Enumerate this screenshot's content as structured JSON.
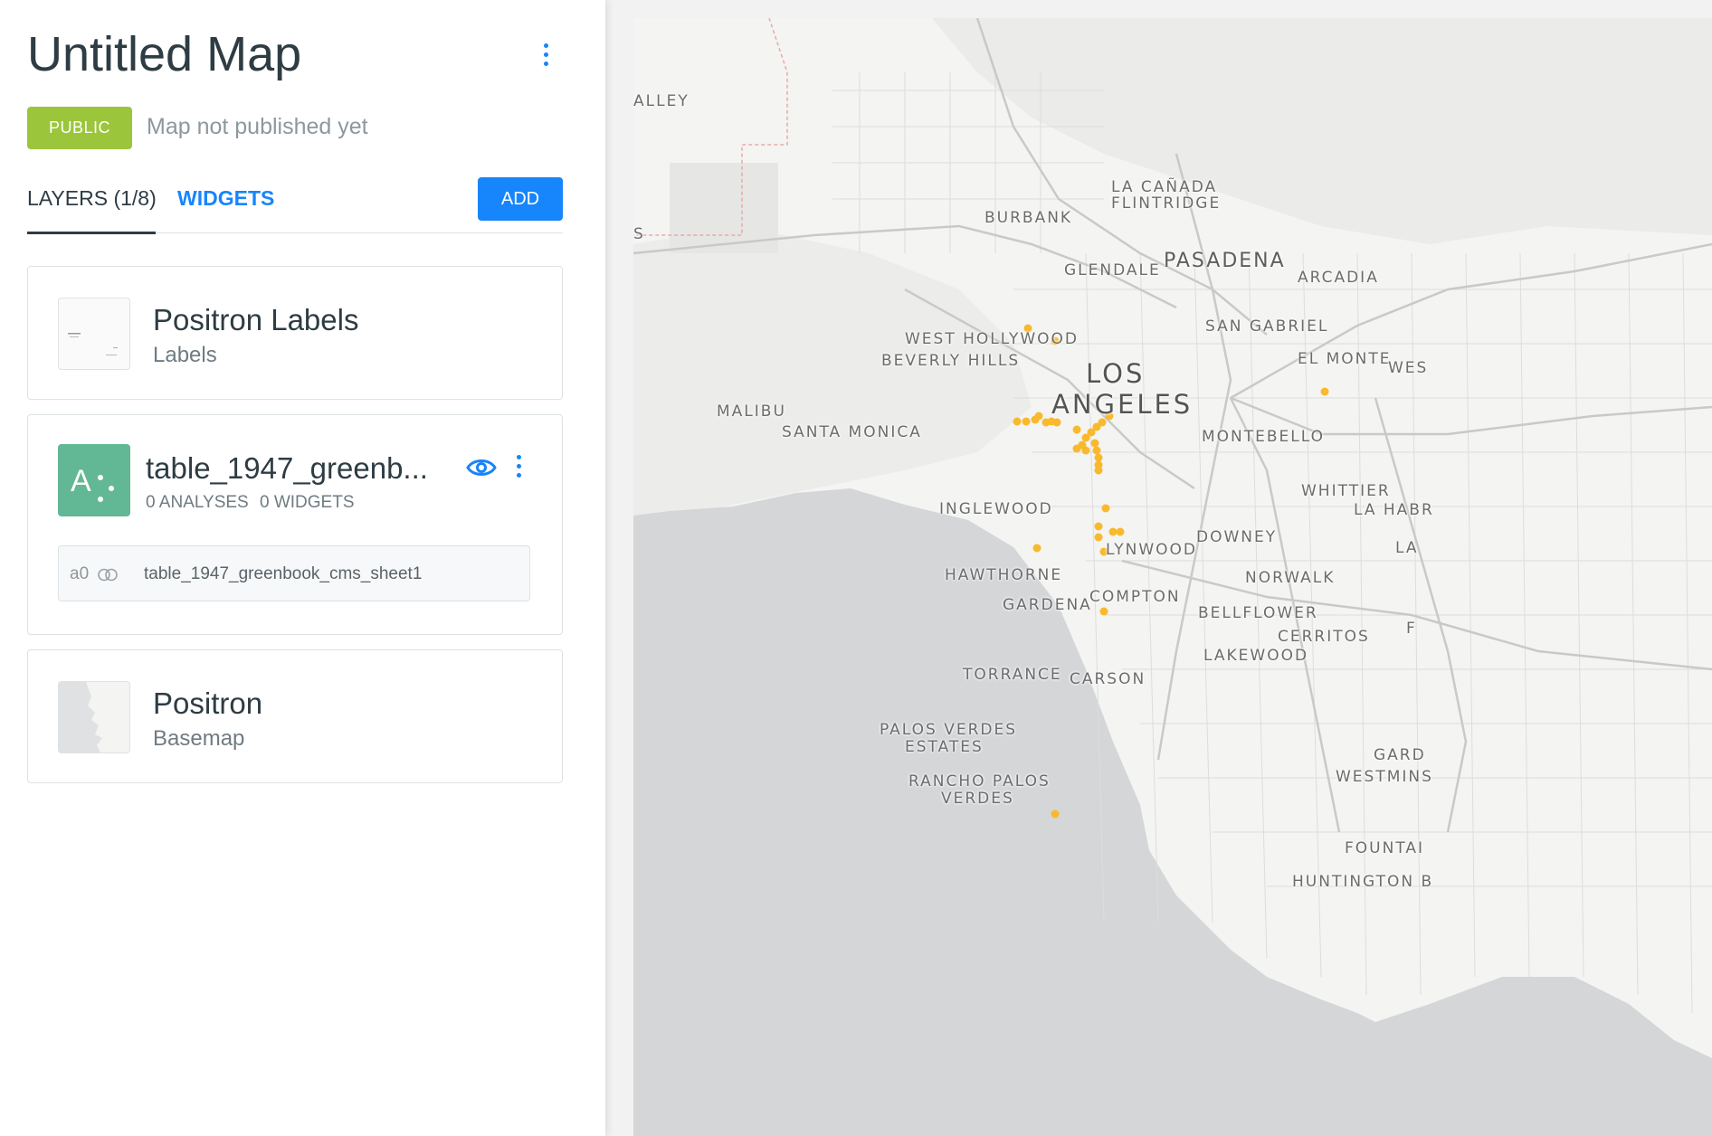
{
  "panel": {
    "title": "Untitled Map",
    "privacy": "PUBLIC",
    "publish_status": "Map not published yet",
    "tabs": [
      {
        "label": "LAYERS (1/8)",
        "active": true
      },
      {
        "label": "WIDGETS",
        "active": false
      }
    ],
    "add_label": "ADD"
  },
  "layers": [
    {
      "title": "Positron Labels",
      "subtitle": "Labels",
      "type": "labels"
    },
    {
      "title": "table_1947_greenb...",
      "source_letter": "A",
      "analyses": "0 ANALYSES",
      "widgets": "0 WIDGETS",
      "analysis_node": {
        "id": "a0",
        "name": "table_1947_greenbook_cms_sheet1"
      },
      "color": "#62b894"
    },
    {
      "title": "Positron",
      "subtitle": "Basemap",
      "type": "basemap"
    }
  ],
  "map": {
    "point_color": "#f9b92c",
    "places": [
      {
        "id": "alley",
        "label": "ALLEY"
      },
      {
        "id": "la-canada",
        "label": "LA CAÑADA"
      },
      {
        "id": "flintridge",
        "label": "FLINTRIDGE"
      },
      {
        "id": "burbank",
        "label": "BURBANK"
      },
      {
        "id": "glendale",
        "label": "GLENDALE"
      },
      {
        "id": "pasadena",
        "label": "PASADENA"
      },
      {
        "id": "arcadia",
        "label": "ARCADIA"
      },
      {
        "id": "san-gabriel",
        "label": "SAN GABRIEL"
      },
      {
        "id": "west-hollywood",
        "label": "WEST HOLLYWOOD"
      },
      {
        "id": "beverly-hills",
        "label": "BEVERLY HILLS"
      },
      {
        "id": "los",
        "label": "LOS"
      },
      {
        "id": "angeles",
        "label": "ANGELES"
      },
      {
        "id": "el-monte",
        "label": "EL MONTE"
      },
      {
        "id": "wes",
        "label": "WES"
      },
      {
        "id": "malibu",
        "label": "MALIBU"
      },
      {
        "id": "santa-monica",
        "label": "SANTA MONICA"
      },
      {
        "id": "montebello",
        "label": "MONTEBELLO"
      },
      {
        "id": "whittier",
        "label": "WHITTIER"
      },
      {
        "id": "la-habr",
        "label": "LA HABR"
      },
      {
        "id": "inglewood",
        "label": "INGLEWOOD"
      },
      {
        "id": "downey",
        "label": "DOWNEY"
      },
      {
        "id": "la",
        "label": "LA"
      },
      {
        "id": "lynwood",
        "label": "LYNWOOD"
      },
      {
        "id": "hawthorne",
        "label": "HAWTHORNE"
      },
      {
        "id": "norwalk",
        "label": "NORWALK"
      },
      {
        "id": "gardena",
        "label": "GARDENA"
      },
      {
        "id": "compton",
        "label": "COMPTON"
      },
      {
        "id": "bellflower",
        "label": "BELLFLOWER"
      },
      {
        "id": "cerritos",
        "label": "CERRITOS"
      },
      {
        "id": "f",
        "label": "F"
      },
      {
        "id": "lakewood",
        "label": "LAKEWOOD"
      },
      {
        "id": "torrance",
        "label": "TORRANCE"
      },
      {
        "id": "carson",
        "label": "CARSON"
      },
      {
        "id": "palos-verdes-estates",
        "label": "PALOS VERDES"
      },
      {
        "id": "estates",
        "label": "ESTATES"
      },
      {
        "id": "gard",
        "label": "GARD"
      },
      {
        "id": "westmins",
        "label": "WESTMINS"
      },
      {
        "id": "rancho",
        "label": "RANCHO PALOS"
      },
      {
        "id": "verdes",
        "label": "VERDES"
      },
      {
        "id": "fountai",
        "label": "FOUNTAI"
      },
      {
        "id": "huntington",
        "label": "HUNTINGTON B"
      },
      {
        "id": "s",
        "label": "S"
      }
    ]
  }
}
